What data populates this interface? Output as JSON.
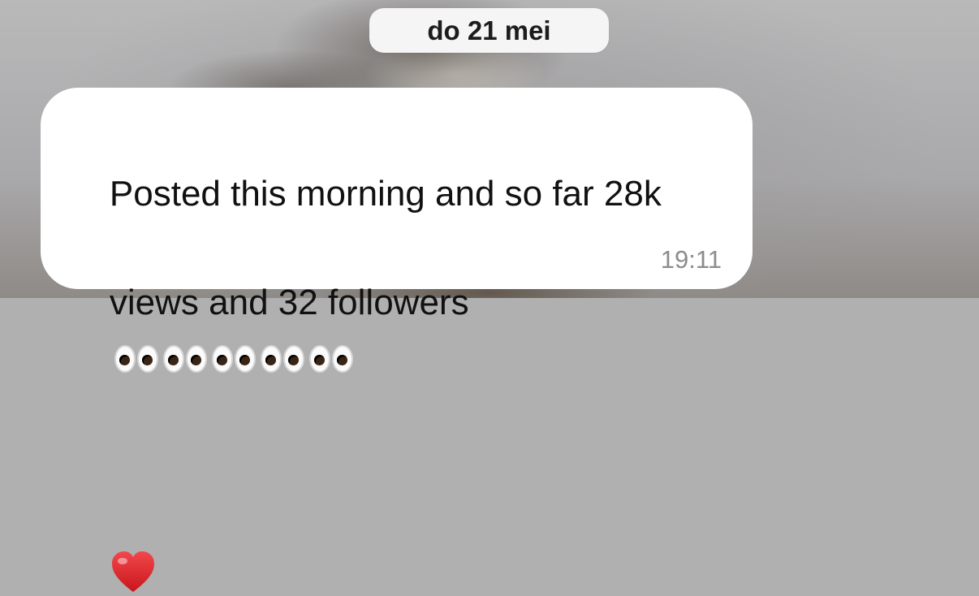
{
  "date_separator": {
    "label": "do 21 mei"
  },
  "message": {
    "text_line1": "Posted this morning and so far 28k",
    "text_line2": "views and 32 followers",
    "emojis": [
      "eyes-emoji",
      "eyes-emoji",
      "eyes-emoji",
      "eyes-emoji",
      "eyes-emoji",
      "red-heart-emoji"
    ],
    "time": "19:11"
  },
  "colors": {
    "bubble": "#ffffff",
    "pill": "#f5f5f5",
    "text": "#111111",
    "timestamp": "#8c8c8c",
    "heart": "#e0242b"
  }
}
